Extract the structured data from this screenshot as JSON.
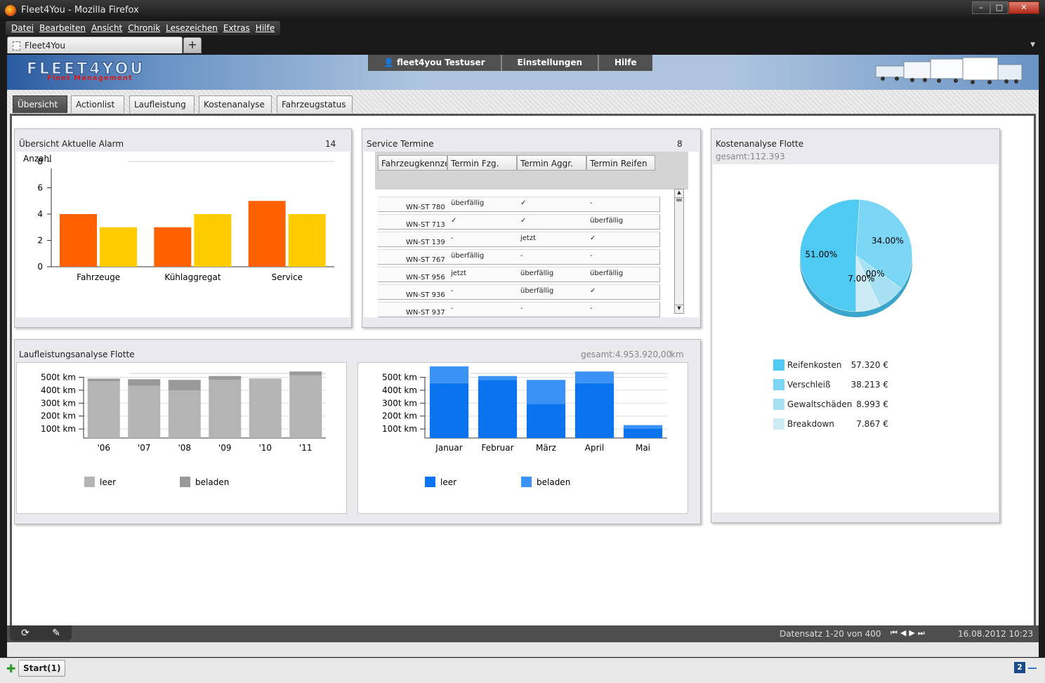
{
  "window": {
    "title": "Fleet4You - Mozilla Firefox",
    "controls": [
      "–",
      "□",
      "✕"
    ]
  },
  "menu": [
    "Datei",
    "Bearbeiten",
    "Ansicht",
    "Chronik",
    "Lesezeichen",
    "Extras",
    "Hilfe"
  ],
  "browser_tab": {
    "title": "Fleet4You",
    "new_tab": "+"
  },
  "header": {
    "logo": "FLEET4YOU",
    "logo_sub": "Fleet Management",
    "user": "fleet4you Testuser",
    "settings": "Einstellungen",
    "help": "Hilfe"
  },
  "tabs": [
    "Übersicht",
    "Actionlist",
    "Laufleistung",
    "Kostenanalyse",
    "Fahrzeugstatus"
  ],
  "alarm": {
    "title": "Übersicht Aktuelle Alarm",
    "count": "14"
  },
  "service": {
    "title": "Service Termine",
    "count": "8",
    "columns": [
      "Fahrzeugkennzeichen",
      "Termin Fzg.",
      "Termin Aggr.",
      "Termin Reifen"
    ],
    "rows": [
      [
        "WN-ST 780",
        "überfällig",
        "✓",
        "-"
      ],
      [
        "WN-ST 713",
        "✓",
        "✓",
        "überfällig"
      ],
      [
        "WN-ST 139",
        "-",
        "jetzt",
        "✓"
      ],
      [
        "WN-ST 767",
        "überfällig",
        "-",
        "-"
      ],
      [
        "WN-ST 956",
        "jetzt",
        "überfällig",
        "überfällig"
      ],
      [
        "WN-ST 936",
        "-",
        "überfällig",
        "✓"
      ],
      [
        "WN-ST 937",
        "-",
        "-",
        "-"
      ]
    ]
  },
  "kosten": {
    "title": "Kostenanalyse Flotte",
    "total": "gesamt:112.393",
    "legend": [
      {
        "name": "Reifenkosten",
        "value": "57.320 €",
        "color": "#4fcaf2"
      },
      {
        "name": "Verschleiß",
        "value": "38.213 €",
        "color": "#7ad6f4"
      },
      {
        "name": "Gewaltschäden",
        "value": "8.993 €",
        "color": "#a6e0f2"
      },
      {
        "name": "Breakdown",
        "value": "7.867 €",
        "color": "#cdebf5"
      }
    ]
  },
  "lauf": {
    "title": "Laufleistungsanalyse Flotte",
    "total": "gesamt:4.953.920,00",
    "unit": "km"
  },
  "bottom": {
    "records": "Datensatz 1-20 von 400",
    "datetime": "16.08.2012 10:23",
    "refresh_icon": "⟳",
    "edit_icon": "✎",
    "nav_icons": [
      "⏮",
      "◀",
      "▶",
      "⏭"
    ]
  },
  "statusbar": {
    "start": "Start(1)",
    "badge": "2"
  },
  "chart_data": [
    {
      "type": "bar",
      "title": "",
      "ylabel": "Anzahl",
      "categories": [
        "Fahrzeuge",
        "Kühlaggregat",
        "Service"
      ],
      "series": [
        {
          "values": [
            4,
            3,
            5
          ],
          "color": "#ff6000"
        },
        {
          "values": [
            3,
            4,
            4
          ],
          "color": "#ffcc00"
        }
      ],
      "yticks": [
        0,
        2,
        4,
        6,
        8
      ],
      "ylim": [
        0,
        8
      ]
    },
    {
      "type": "pie",
      "labels": [
        "Reifenkosten",
        "Verschleiß",
        "Gewaltschäden",
        "Breakdown"
      ],
      "values": [
        51,
        34,
        8,
        7
      ],
      "value_labels": [
        "51.00%",
        "34.00%",
        "8.00%",
        "7.00%"
      ],
      "colors": [
        "#4fcaf2",
        "#7ad6f4",
        "#a6e0f2",
        "#cdebf5"
      ]
    },
    {
      "type": "bar",
      "stacked": true,
      "categories": [
        "'06",
        "'07",
        "'08",
        "'09",
        "'10",
        "'11"
      ],
      "series": [
        {
          "name": "leer",
          "values": [
            440,
            405,
            370,
            450,
            455,
            485
          ],
          "color": "#b4b4b4"
        },
        {
          "name": "beladen",
          "values": [
            20,
            50,
            80,
            30,
            5,
            30
          ],
          "color": "#999999"
        }
      ],
      "yticks": [
        100,
        200,
        300,
        400,
        500
      ],
      "ytick_labels": [
        "100t km",
        "200t km",
        "300t km",
        "400t km",
        "500t km"
      ],
      "ylim": [
        30,
        530
      ]
    },
    {
      "type": "bar",
      "stacked": true,
      "categories": [
        "Januar",
        "Februar",
        "März",
        "April",
        "Mai"
      ],
      "series": [
        {
          "name": "leer",
          "values": [
            425,
            450,
            265,
            425,
            75
          ],
          "color": "#0a74f0"
        },
        {
          "name": "beladen",
          "values": [
            130,
            30,
            185,
            90,
            25
          ],
          "color": "#3a92f6"
        }
      ],
      "yticks": [
        100,
        200,
        300,
        400,
        500
      ],
      "ytick_labels": [
        "100t km",
        "200t km",
        "300t km",
        "400t km",
        "500t km"
      ],
      "ylim": [
        30,
        530
      ]
    }
  ]
}
